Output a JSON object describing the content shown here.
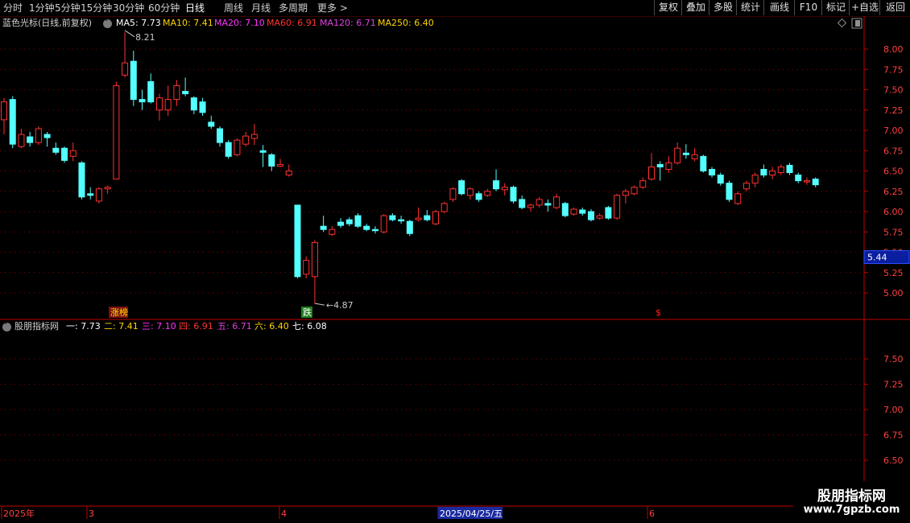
{
  "toolbar": {
    "periods": [
      "分时",
      "1分钟",
      "5分钟",
      "15分钟",
      "30分钟",
      "60分钟",
      "日线",
      "周线",
      "月线",
      "多周期",
      "更多 >"
    ],
    "active_period": "日线",
    "buttons": [
      "复权",
      "叠加",
      "多股",
      "统计",
      "画线",
      "F10",
      "标记",
      "+自选",
      "返回"
    ]
  },
  "main_panel": {
    "title": "蓝色光标(日线,前复权)",
    "ma": [
      {
        "label": "MA5: 7.73",
        "color": "#ffffff"
      },
      {
        "label": "MA10: 7.41",
        "color": "#ffd400"
      },
      {
        "label": "MA20: 7.10",
        "color": "#ff33ff"
      },
      {
        "label": "MA60: 6.91",
        "color": "#ff3333"
      },
      {
        "label": "MA120: 6.71",
        "color": "#e040e0"
      },
      {
        "label": "MA250: 6.40",
        "color": "#ffd400"
      }
    ],
    "y_ticks": [
      "8.00",
      "7.75",
      "7.50",
      "7.25",
      "7.00",
      "6.75",
      "6.50",
      "6.25",
      "6.00",
      "5.75",
      "5.50",
      "5.25",
      "5.00"
    ],
    "current_price": "5.44",
    "high_label": "8.21",
    "low_label": "4.87",
    "markers": [
      {
        "text": "涨榜",
        "color": "#ffe000",
        "bg": "#7a1010"
      },
      {
        "text": "跌",
        "color": "#ffffff",
        "bg": "#208020"
      },
      {
        "text": "$",
        "color": "#ff2020",
        "bg": ""
      }
    ]
  },
  "sub_panel": {
    "title": "股朋指标网",
    "values": [
      {
        "label": "一: 7.73",
        "color": "#ffffff"
      },
      {
        "label": "二: 7.41",
        "color": "#ffd400"
      },
      {
        "label": "三: 7.10",
        "color": "#ff33ff"
      },
      {
        "label": "四: 6.91",
        "color": "#ff3333"
      },
      {
        "label": "五: 6.71",
        "color": "#e040e0"
      },
      {
        "label": "六: 6.40",
        "color": "#ffd400"
      },
      {
        "label": "七: 6.08",
        "color": "#ffffff"
      }
    ],
    "y_ticks": [
      "7.50",
      "7.25",
      "7.00",
      "6.75",
      "6.50"
    ]
  },
  "date_axis": {
    "labels": [
      "2025年",
      "3",
      "4",
      "2025/04/25/五",
      "6"
    ]
  },
  "watermark": {
    "title": "股朋指标网",
    "url": "www.7gpzb.com"
  },
  "colors": {
    "up": "#ff3030",
    "down": "#54ffff",
    "grid": "#8a0000",
    "axis": "#c00000",
    "price_box": "#0a1ea0"
  },
  "chart_data": {
    "type": "candlestick",
    "ylim": [
      4.85,
      8.3
    ],
    "series": [
      {
        "o": 7.13,
        "c": 7.35,
        "h": 7.4,
        "l": 6.95,
        "up": true,
        "note": "pre-visible"
      },
      {
        "o": 7.38,
        "c": 6.83,
        "h": 7.42,
        "l": 6.78,
        "up": false
      },
      {
        "o": 6.8,
        "c": 6.95,
        "h": 7.02,
        "l": 6.78,
        "up": true
      },
      {
        "o": 6.92,
        "c": 6.85,
        "h": 6.98,
        "l": 6.8,
        "up": false
      },
      {
        "o": 6.85,
        "c": 7.02,
        "h": 7.05,
        "l": 6.82,
        "up": true
      },
      {
        "o": 6.95,
        "c": 6.91,
        "h": 6.98,
        "l": 6.8,
        "up": false
      },
      {
        "o": 6.78,
        "c": 6.73,
        "h": 6.85,
        "l": 6.7,
        "up": false
      },
      {
        "o": 6.78,
        "c": 6.63,
        "h": 6.8,
        "l": 6.6,
        "up": false
      },
      {
        "o": 6.68,
        "c": 6.75,
        "h": 6.85,
        "l": 6.62,
        "up": true
      },
      {
        "o": 6.6,
        "c": 6.18,
        "h": 6.62,
        "l": 6.15,
        "up": false
      },
      {
        "o": 6.22,
        "c": 6.2,
        "h": 6.3,
        "l": 6.15,
        "up": false
      },
      {
        "o": 6.13,
        "c": 6.28,
        "h": 6.3,
        "l": 6.1,
        "up": true
      },
      {
        "o": 6.28,
        "c": 6.3,
        "h": 6.32,
        "l": 6.22,
        "up": true
      },
      {
        "o": 6.4,
        "c": 7.55,
        "h": 7.6,
        "l": 6.4,
        "up": true
      },
      {
        "o": 7.68,
        "c": 7.83,
        "h": 8.21,
        "l": 7.65,
        "up": true
      },
      {
        "o": 7.85,
        "c": 7.38,
        "h": 7.98,
        "l": 7.3,
        "up": false
      },
      {
        "o": 7.38,
        "c": 7.35,
        "h": 7.5,
        "l": 7.25,
        "up": false
      },
      {
        "o": 7.6,
        "c": 7.35,
        "h": 7.7,
        "l": 7.33,
        "up": false
      },
      {
        "o": 7.25,
        "c": 7.4,
        "h": 7.45,
        "l": 7.12,
        "up": true
      },
      {
        "o": 7.25,
        "c": 7.38,
        "h": 7.55,
        "l": 7.18,
        "up": true
      },
      {
        "o": 7.38,
        "c": 7.55,
        "h": 7.62,
        "l": 7.3,
        "up": true
      },
      {
        "o": 7.48,
        "c": 7.45,
        "h": 7.65,
        "l": 7.42,
        "up": false
      },
      {
        "o": 7.4,
        "c": 7.25,
        "h": 7.42,
        "l": 7.2,
        "up": false
      },
      {
        "o": 7.35,
        "c": 7.22,
        "h": 7.4,
        "l": 7.18,
        "up": false
      },
      {
        "o": 7.1,
        "c": 7.05,
        "h": 7.18,
        "l": 7.02,
        "up": false
      },
      {
        "o": 7.02,
        "c": 6.85,
        "h": 7.05,
        "l": 6.8,
        "up": false
      },
      {
        "o": 6.85,
        "c": 6.68,
        "h": 6.88,
        "l": 6.65,
        "up": false
      },
      {
        "o": 6.7,
        "c": 6.88,
        "h": 6.9,
        "l": 6.68,
        "up": true
      },
      {
        "o": 6.83,
        "c": 6.93,
        "h": 6.98,
        "l": 6.8,
        "up": true
      },
      {
        "o": 6.9,
        "c": 6.95,
        "h": 7.08,
        "l": 6.82,
        "up": true
      },
      {
        "o": 6.75,
        "c": 6.73,
        "h": 6.82,
        "l": 6.55,
        "up": false
      },
      {
        "o": 6.7,
        "c": 6.56,
        "h": 6.72,
        "l": 6.5,
        "up": false
      },
      {
        "o": 6.56,
        "c": 6.58,
        "h": 6.65,
        "l": 6.55,
        "up": true
      },
      {
        "o": 6.45,
        "c": 6.5,
        "h": 6.58,
        "l": 6.43,
        "up": true
      },
      {
        "o": 6.08,
        "c": 5.2,
        "h": 6.08,
        "l": 5.18,
        "up": false
      },
      {
        "o": 5.23,
        "c": 5.4,
        "h": 5.45,
        "l": 5.18,
        "up": true
      },
      {
        "o": 5.2,
        "c": 5.62,
        "h": 5.65,
        "l": 4.87,
        "up": true
      },
      {
        "o": 5.82,
        "c": 5.78,
        "h": 5.95,
        "l": 5.75,
        "up": false
      },
      {
        "o": 5.72,
        "c": 5.78,
        "h": 5.82,
        "l": 5.7,
        "up": true
      },
      {
        "o": 5.87,
        "c": 5.83,
        "h": 5.92,
        "l": 5.8,
        "up": false
      },
      {
        "o": 5.9,
        "c": 5.85,
        "h": 5.93,
        "l": 5.82,
        "up": false
      },
      {
        "o": 5.95,
        "c": 5.82,
        "h": 5.98,
        "l": 5.8,
        "up": false
      },
      {
        "o": 5.82,
        "c": 5.78,
        "h": 5.85,
        "l": 5.76,
        "up": false
      },
      {
        "o": 5.78,
        "c": 5.78,
        "h": 5.82,
        "l": 5.73,
        "up": false
      },
      {
        "o": 5.75,
        "c": 5.95,
        "h": 5.97,
        "l": 5.73,
        "up": true
      },
      {
        "o": 5.95,
        "c": 5.9,
        "h": 5.98,
        "l": 5.88,
        "up": false
      },
      {
        "o": 5.9,
        "c": 5.9,
        "h": 5.95,
        "l": 5.85,
        "up": false
      },
      {
        "o": 5.88,
        "c": 5.73,
        "h": 5.9,
        "l": 5.7,
        "up": false
      },
      {
        "o": 5.9,
        "c": 5.92,
        "h": 6.05,
        "l": 5.88,
        "up": true
      },
      {
        "o": 5.95,
        "c": 5.9,
        "h": 6.02,
        "l": 5.88,
        "up": false
      },
      {
        "o": 5.85,
        "c": 6.0,
        "h": 6.02,
        "l": 5.83,
        "up": true
      },
      {
        "o": 6.0,
        "c": 6.1,
        "h": 6.12,
        "l": 5.98,
        "up": true
      },
      {
        "o": 6.15,
        "c": 6.28,
        "h": 6.3,
        "l": 6.12,
        "up": true
      },
      {
        "o": 6.38,
        "c": 6.22,
        "h": 6.4,
        "l": 6.2,
        "up": false
      },
      {
        "o": 6.2,
        "c": 6.28,
        "h": 6.3,
        "l": 6.15,
        "up": true
      },
      {
        "o": 6.22,
        "c": 6.15,
        "h": 6.25,
        "l": 6.12,
        "up": false
      },
      {
        "o": 6.2,
        "c": 6.25,
        "h": 6.28,
        "l": 6.18,
        "up": true
      },
      {
        "o": 6.38,
        "c": 6.28,
        "h": 6.52,
        "l": 6.25,
        "up": false
      },
      {
        "o": 6.27,
        "c": 6.3,
        "h": 6.35,
        "l": 6.2,
        "up": true
      },
      {
        "o": 6.3,
        "c": 6.13,
        "h": 6.32,
        "l": 6.1,
        "up": false
      },
      {
        "o": 6.15,
        "c": 6.05,
        "h": 6.2,
        "l": 6.03,
        "up": false
      },
      {
        "o": 6.05,
        "c": 6.08,
        "h": 6.1,
        "l": 6.0,
        "up": true
      },
      {
        "o": 6.08,
        "c": 6.15,
        "h": 6.18,
        "l": 6.05,
        "up": true
      },
      {
        "o": 6.1,
        "c": 6.08,
        "h": 6.15,
        "l": 6.0,
        "up": false
      },
      {
        "o": 6.05,
        "c": 6.18,
        "h": 6.22,
        "l": 6.03,
        "up": true
      },
      {
        "o": 6.1,
        "c": 5.95,
        "h": 6.12,
        "l": 5.93,
        "up": false
      },
      {
        "o": 5.97,
        "c": 6.03,
        "h": 6.05,
        "l": 5.95,
        "up": true
      },
      {
        "o": 6.02,
        "c": 5.98,
        "h": 6.05,
        "l": 5.95,
        "up": false
      },
      {
        "o": 6.0,
        "c": 5.9,
        "h": 6.03,
        "l": 5.88,
        "up": false
      },
      {
        "o": 5.92,
        "c": 5.95,
        "h": 5.98,
        "l": 5.9,
        "up": true
      },
      {
        "o": 6.05,
        "c": 5.92,
        "h": 6.07,
        "l": 5.9,
        "up": false
      },
      {
        "o": 5.92,
        "c": 6.2,
        "h": 6.22,
        "l": 5.9,
        "up": true
      },
      {
        "o": 6.2,
        "c": 6.25,
        "h": 6.28,
        "l": 6.1,
        "up": true
      },
      {
        "o": 6.22,
        "c": 6.3,
        "h": 6.32,
        "l": 6.2,
        "up": true
      },
      {
        "o": 6.3,
        "c": 6.38,
        "h": 6.42,
        "l": 6.28,
        "up": true
      },
      {
        "o": 6.4,
        "c": 6.55,
        "h": 6.72,
        "l": 6.38,
        "up": true
      },
      {
        "o": 6.58,
        "c": 6.55,
        "h": 6.62,
        "l": 6.38,
        "up": false
      },
      {
        "o": 6.52,
        "c": 6.6,
        "h": 6.68,
        "l": 6.48,
        "up": true
      },
      {
        "o": 6.6,
        "c": 6.78,
        "h": 6.85,
        "l": 6.58,
        "up": true
      },
      {
        "o": 6.7,
        "c": 6.72,
        "h": 6.83,
        "l": 6.65,
        "up": false
      },
      {
        "o": 6.65,
        "c": 6.7,
        "h": 6.78,
        "l": 6.62,
        "up": true
      },
      {
        "o": 6.68,
        "c": 6.5,
        "h": 6.7,
        "l": 6.48,
        "up": false
      },
      {
        "o": 6.52,
        "c": 6.45,
        "h": 6.55,
        "l": 6.42,
        "up": false
      },
      {
        "o": 6.45,
        "c": 6.35,
        "h": 6.48,
        "l": 6.32,
        "up": false
      },
      {
        "o": 6.35,
        "c": 6.15,
        "h": 6.38,
        "l": 6.12,
        "up": false
      },
      {
        "o": 6.1,
        "c": 6.22,
        "h": 6.25,
        "l": 6.08,
        "up": true
      },
      {
        "o": 6.28,
        "c": 6.35,
        "h": 6.38,
        "l": 6.25,
        "up": true
      },
      {
        "o": 6.35,
        "c": 6.45,
        "h": 6.48,
        "l": 6.3,
        "up": true
      },
      {
        "o": 6.52,
        "c": 6.45,
        "h": 6.58,
        "l": 6.42,
        "up": false
      },
      {
        "o": 6.45,
        "c": 6.5,
        "h": 6.55,
        "l": 6.4,
        "up": true
      },
      {
        "o": 6.48,
        "c": 6.55,
        "h": 6.58,
        "l": 6.45,
        "up": true
      },
      {
        "o": 6.57,
        "c": 6.48,
        "h": 6.6,
        "l": 6.45,
        "up": false
      },
      {
        "o": 6.45,
        "c": 6.38,
        "h": 6.48,
        "l": 6.35,
        "up": false
      },
      {
        "o": 6.38,
        "c": 6.38,
        "h": 6.42,
        "l": 6.33,
        "up": true
      },
      {
        "o": 6.4,
        "c": 6.33,
        "h": 6.42,
        "l": 6.3,
        "up": false
      }
    ]
  }
}
